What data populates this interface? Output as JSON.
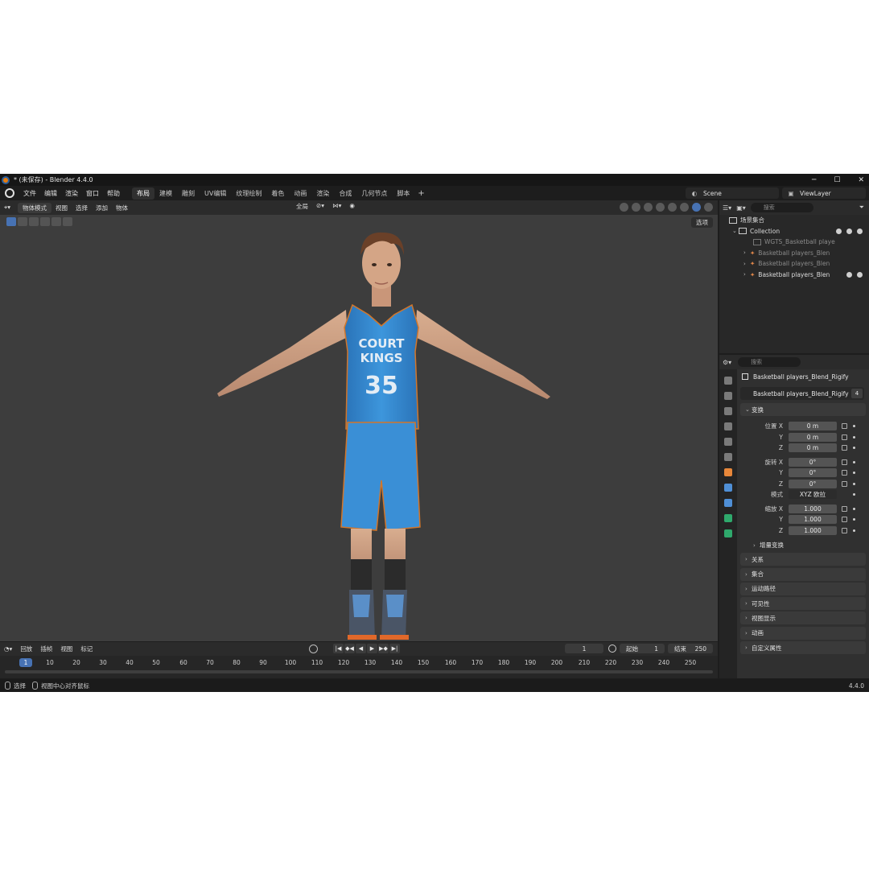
{
  "window": {
    "title": "* (未保存) - Blender 4.4.0",
    "controls": [
      "─",
      "☐",
      "✕"
    ]
  },
  "menubar": {
    "items": [
      "文件",
      "编辑",
      "渲染",
      "窗口",
      "帮助"
    ],
    "workspaces": [
      "布局",
      "建模",
      "雕刻",
      "UV编辑",
      "纹理绘制",
      "着色",
      "动画",
      "渲染",
      "合成",
      "几何节点",
      "脚本"
    ],
    "active_workspace": "布局",
    "add_tab": "+",
    "scene": "Scene",
    "view_layer": "ViewLayer"
  },
  "viewport_header": {
    "mode": "物体模式",
    "menus": [
      "视图",
      "选择",
      "添加",
      "物体"
    ],
    "transform_orientation": "全局",
    "options": "选项"
  },
  "model": {
    "jersey_line1": "COURT",
    "jersey_line2": "KINGS",
    "jersey_number": "35",
    "jersey_color": "#3a8fd6",
    "skin_color": "#c79a7e",
    "hair_color": "#6a4028",
    "sock_color": "#2b2b2b"
  },
  "timeline": {
    "menus": [
      "回放",
      "插帧",
      "视图",
      "标记"
    ],
    "current_frame": "1",
    "start_label": "起始",
    "start": "1",
    "end_label": "结束",
    "end": "250",
    "ticks": [
      "10",
      "20",
      "30",
      "40",
      "50",
      "60",
      "70",
      "80",
      "90",
      "100",
      "110",
      "120",
      "130",
      "140",
      "150",
      "160",
      "170",
      "180",
      "190",
      "200",
      "210",
      "220",
      "230",
      "240",
      "250"
    ],
    "playhead": "1"
  },
  "statusbar": {
    "select": "选择",
    "center_view": "视图中心对齐鼠标",
    "version": "4.4.0"
  },
  "outliner": {
    "search_placeholder": "搜索",
    "scene_collection": "场景集合",
    "collection": "Collection",
    "items": [
      "WGTS_Basketball playe",
      "Basketball players_Blen",
      "Basketball players_Blen",
      "Basketball players_Blen"
    ]
  },
  "properties": {
    "search_placeholder": "搜索",
    "object_name": "Basketball players_Blend_Rigify",
    "data_name": "Basketball players_Blend_Rigify",
    "data_users": "4",
    "transform_title": "变换",
    "location_label": "位置 X",
    "location": [
      "0 m",
      "0 m",
      "0 m"
    ],
    "rotation_label": "旋转 X",
    "rotation": [
      "0°",
      "0°",
      "0°"
    ],
    "mode_label": "模式",
    "mode_value": "XYZ 欧拉",
    "scale_label": "缩放 X",
    "scale": [
      "1.000",
      "1.000",
      "1.000"
    ],
    "axis_y": "Y",
    "axis_z": "Z",
    "delta_transform": "增量变换",
    "panels": [
      "关系",
      "集合",
      "运动路径",
      "可见性",
      "视图显示",
      "动画",
      "自定义属性"
    ]
  }
}
